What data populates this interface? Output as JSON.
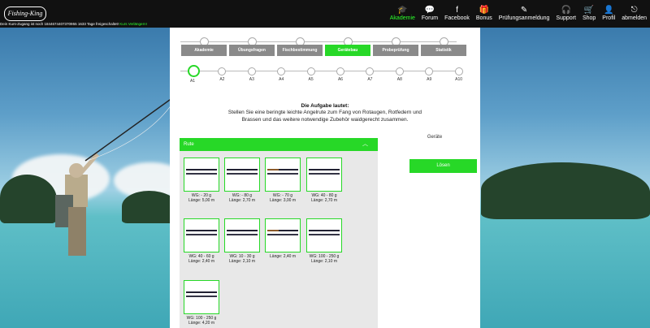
{
  "header": {
    "logo_text": "Fishing-King",
    "info_text": "Dein Kurs-Zugang ist noch 1844674407370955 1633 Tage freigeschaltet!",
    "info_link": "Kurs Verlängern!",
    "nav": [
      {
        "label": "Akademie",
        "icon": "graduation-cap-icon",
        "glyph": "🎓",
        "active": true
      },
      {
        "label": "Forum",
        "icon": "chat-icon",
        "glyph": "💬",
        "active": false
      },
      {
        "label": "Facebook",
        "icon": "facebook-icon",
        "glyph": "f",
        "active": false
      },
      {
        "label": "Bonus",
        "icon": "gift-icon",
        "glyph": "🎁",
        "active": false
      },
      {
        "label": "Prüfungsanmeldung",
        "icon": "edit-icon",
        "glyph": "✎",
        "active": false
      },
      {
        "label": "Support",
        "icon": "headset-icon",
        "glyph": "🎧",
        "active": false
      },
      {
        "label": "Shop",
        "icon": "cart-icon",
        "glyph": "🛒",
        "active": false
      },
      {
        "label": "Profil",
        "icon": "user-icon",
        "glyph": "👤",
        "active": false
      },
      {
        "label": "abmelden",
        "icon": "logout-icon",
        "glyph": "⎋",
        "active": false
      }
    ]
  },
  "categories": [
    "Akademie",
    "Übungsfragen",
    "Fischbestimmung",
    "Gerätebau",
    "Probeprüfung",
    "Statistik"
  ],
  "active_category": 3,
  "substeps": [
    "A1",
    "A2",
    "A3",
    "A4",
    "A5",
    "A6",
    "A7",
    "A8",
    "A9",
    "A10"
  ],
  "active_substep": 0,
  "task": {
    "title": "Die Aufgabe lautet:",
    "text": "Stellen Sie eine beringte leichte Angelrute zum Fang von Rotaugen, Rotfedern und Brassen und das weitere notwendige Zubehör waidgerecht zusammen."
  },
  "geraete_label": "Geräte",
  "solve_button": "Lösen",
  "rod_section": {
    "title": "Rute",
    "rods": [
      {
        "wg": "WG: - 20 g",
        "laenge": "Länge: 5,00 m",
        "icon": "rod-image"
      },
      {
        "wg": "WG: - 80 g",
        "laenge": "Länge: 2,70 m",
        "icon": "rod-image"
      },
      {
        "wg": "WG: - 70 g",
        "laenge": "Länge: 3,00 m",
        "icon": "rod-image"
      },
      {
        "wg": "WG: 40 - 80 g",
        "laenge": "Länge: 2,70 m",
        "icon": "rod-image"
      },
      {
        "wg": "WG: 40 - 60 g",
        "laenge": "Länge: 2,40 m",
        "icon": "rod-image"
      },
      {
        "wg": "WG: 10 - 30 g",
        "laenge": "Länge: 2,10 m",
        "icon": "rod-image"
      },
      {
        "wg": "",
        "laenge": "Länge: 2,40 m",
        "icon": "rod-image"
      },
      {
        "wg": "WG: 100 - 250 g",
        "laenge": "Länge: 2,10 m",
        "icon": "rod-image"
      },
      {
        "wg": "WG: 100 - 250 g",
        "laenge": "Länge: 4,20 m",
        "icon": "rod-image"
      }
    ]
  },
  "colors": {
    "accent": "#27d827",
    "tab_inactive": "#8a8a8a",
    "header_bg": "#111111"
  }
}
